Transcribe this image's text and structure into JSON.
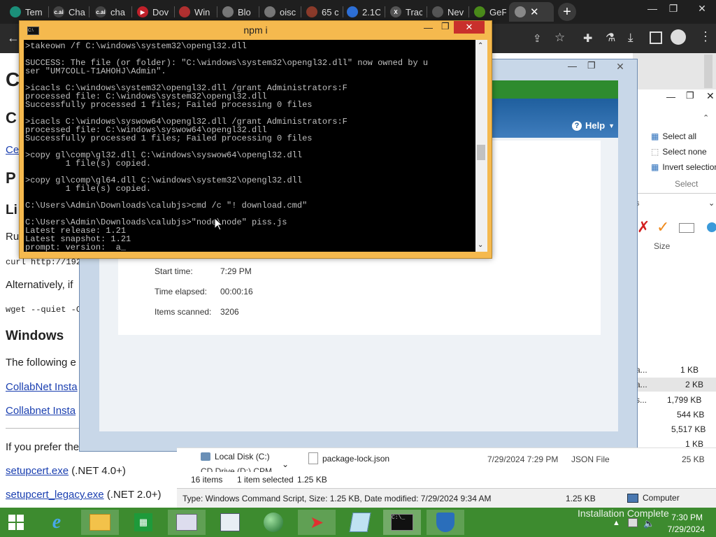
{
  "browser": {
    "tabs": [
      "Tem",
      "Cha",
      "cha",
      "Dov",
      "Win",
      "Blo",
      "oisc",
      "65 c",
      "2.1C",
      "Trac",
      "Nev",
      "GeF"
    ],
    "new_tab_symbol": "+",
    "window_controls": {
      "minimize": "—",
      "restore": "❐",
      "close": "✕"
    }
  },
  "webpage": {
    "heading_c1": "C",
    "heading_c2": "C",
    "link_ce": "Ce",
    "heading_p": "P",
    "heading_li": "Li",
    "text_ru": "Ru",
    "curl_cmd": "curl http://192",
    "alt_text": "Alternatively, if",
    "wget_cmd": "wget --quiet -C",
    "windows_heading": "Windows",
    "following_text": "The following e",
    "link_collabnet1": "CollabNet Insta",
    "link_collabnet2": "Collabnet Insta",
    "prefer_text": "If you prefer the",
    "link_setupcert": "setupcert.exe",
    "setupcert_suffix": "(.NET 4.0+)",
    "link_setupcert_legacy": "setupcert_legacy.exe",
    "setupcert_legacy_suffix": "(.NET 2.0+)"
  },
  "cmd": {
    "title": "npm i",
    "lines": [
      ">takeown /f C:\\windows\\system32\\opengl32.dll",
      "",
      "SUCCESS: The file (or folder): \"C:\\windows\\system32\\opengl32.dll\" now owned by u",
      "ser \"UM7COLL-T1AHOHJ\\Admin\".",
      "",
      ">icacls C:\\windows\\system32\\opengl32.dll /grant Administrators:F",
      "processed file: C:\\windows\\system32\\opengl32.dll",
      "Successfully processed 1 files; Failed processing 0 files",
      "",
      ">icacls C:\\windows\\syswow64\\opengl32.dll /grant Administrators:F",
      "processed file: C:\\windows\\syswow64\\opengl32.dll",
      "Successfully processed 1 files; Failed processing 0 files",
      "",
      ">copy gl\\comp\\gl32.dll C:\\windows\\syswow64\\opengl32.dll",
      "        1 file(s) copied.",
      "",
      ">copy gl\\comp\\gl64.dll C:\\windows\\system32\\opengl32.dll",
      "        1 file(s) copied.",
      "",
      "C:\\Users\\Admin\\Downloads\\calubjs>cmd /c \"! download.cmd\"",
      "",
      "C:\\Users\\Admin\\Downloads\\calubjs>\"node\\node\" piss.js",
      "Latest release: 1.21",
      "Latest snapshot: 1.21",
      "prompt: version:  a_"
    ]
  },
  "installer": {
    "help_label": "Help",
    "start_time_label": "Start time:",
    "start_time_value": "7:29 PM",
    "elapsed_label": "Time elapsed:",
    "elapsed_value": "00:00:16",
    "scanned_label": "Items scanned:",
    "scanned_value": "3206"
  },
  "ribbon": {
    "select_all": "Select all",
    "select_none": "Select none",
    "invert_selection": "Invert selection",
    "group_label": "Select",
    "size_header": "Size"
  },
  "file_sizes": [
    "1 KB",
    "2 KB",
    "1,799 KB",
    "544 KB",
    "5,517 KB",
    "1 KB",
    "25 KB"
  ],
  "size_prefixes": [
    "a...",
    "a...",
    "s...",
    "",
    ""
  ],
  "explorer": {
    "nav_local_disk": "Local Disk (C:)",
    "nav_cd_drive": "CD Drive (D:) CPM",
    "file_name": "package-lock.json",
    "file_date": "7/29/2024 7:29 PM",
    "file_type": "JSON File",
    "file_size": "25 KB",
    "item_count": "16 items",
    "selected": "1 item selected",
    "selected_size": "1.25 KB",
    "details": "Type: Windows Command Script, Size: 1.25 KB, Date modified: 7/29/2024 9:34 AM",
    "details_size": "1.25 KB",
    "computer": "Computer"
  },
  "taskbar": {
    "notification": "Installation Complete",
    "clock_time": "7:30 PM",
    "clock_date": "7/29/2024"
  },
  "colors": {
    "taskbar": "#3d8b2f",
    "cmd_frame": "#f5b94e",
    "installer_accent": "#2e8b2e",
    "link": "#1a3fb0"
  }
}
